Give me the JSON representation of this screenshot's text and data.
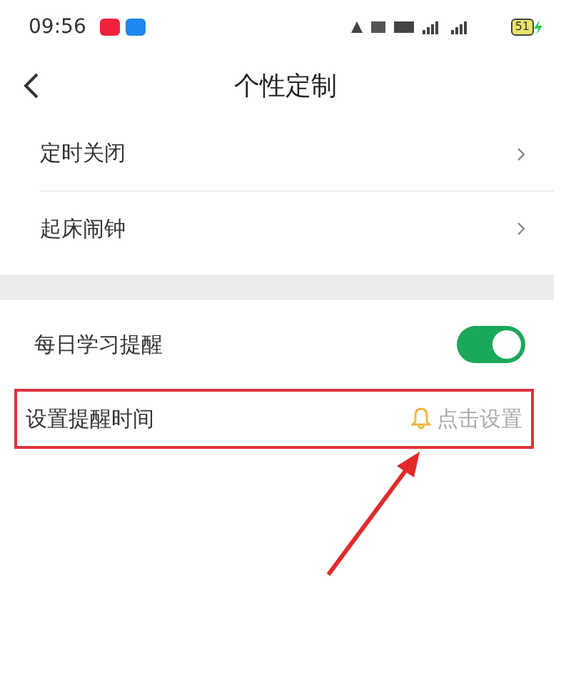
{
  "status_bar": {
    "time": "09:56",
    "battery": "51"
  },
  "header": {
    "title": "个性定制"
  },
  "section_1": [
    {
      "label": "定时关闭"
    },
    {
      "label": "起床闹钟"
    }
  ],
  "reminder": {
    "label": "每日学习提醒",
    "on": true
  },
  "reminder_time": {
    "label": "设置提醒时间",
    "action": "点击设置"
  }
}
